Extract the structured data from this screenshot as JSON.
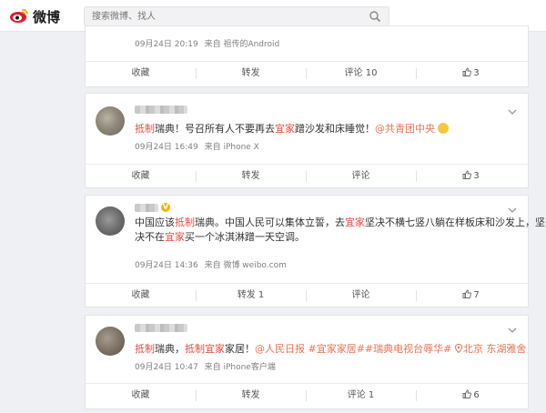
{
  "header": {
    "logo_text": "微博",
    "search_placeholder": "搜索微博、找人"
  },
  "colors": {
    "accent": "#eb7350",
    "highlight": "#e74c3c",
    "badge": "#f4b400"
  },
  "post0": {
    "meta_time": "09月24日 20:19",
    "meta_from": "来自 祖传的Android",
    "actions": {
      "collect": "收藏",
      "repost": "转发",
      "comment": "评论 10",
      "like": "3"
    }
  },
  "post1": {
    "text": {
      "h1": "抵制",
      "t1": "瑞典！号召所有人不要再去",
      "h2": "宜家",
      "t2": "蹭沙发和床睡觉！",
      "mention": "@共青团中央"
    },
    "meta_time": "09月24日 16:49",
    "meta_from": "来自 iPhone X",
    "actions": {
      "collect": "收藏",
      "repost": "转发",
      "comment": "评论",
      "like": "3"
    }
  },
  "post2": {
    "text": {
      "t1": "中国应该",
      "h1": "抵制",
      "t2": "瑞典。中国人民可以集体立誓，去",
      "h2": "宜家",
      "t3": "坚决不横七竖八躺在样板床和沙发上，坚",
      "t4": "决不在",
      "h3": "宜家",
      "t5": "买一个冰淇淋蹭一天空调。"
    },
    "meta_time": "09月24日 14:36",
    "meta_from": "来自 微博 weibo.com",
    "actions": {
      "collect": "收藏",
      "repost": "转发 1",
      "comment": "评论",
      "like": "7"
    }
  },
  "post3": {
    "text": {
      "h1": "抵制",
      "t1": "瑞典，",
      "h2": "抵制宜家",
      "t2": "家居！",
      "link1": "@人民日报",
      "link2": "#宜家家居##瑞典电视台辱华#",
      "location": "北京 东湖雅舍"
    },
    "meta_time": "09月24日 10:47",
    "meta_from": "来自 iPhone客户端",
    "actions": {
      "collect": "收藏",
      "repost": "转发",
      "comment": "评论 1",
      "like": "6"
    }
  },
  "icons": {
    "like": "thumb-up-icon",
    "search": "search-icon",
    "expand": "chevron-down-icon",
    "location": "location-pin-icon"
  }
}
